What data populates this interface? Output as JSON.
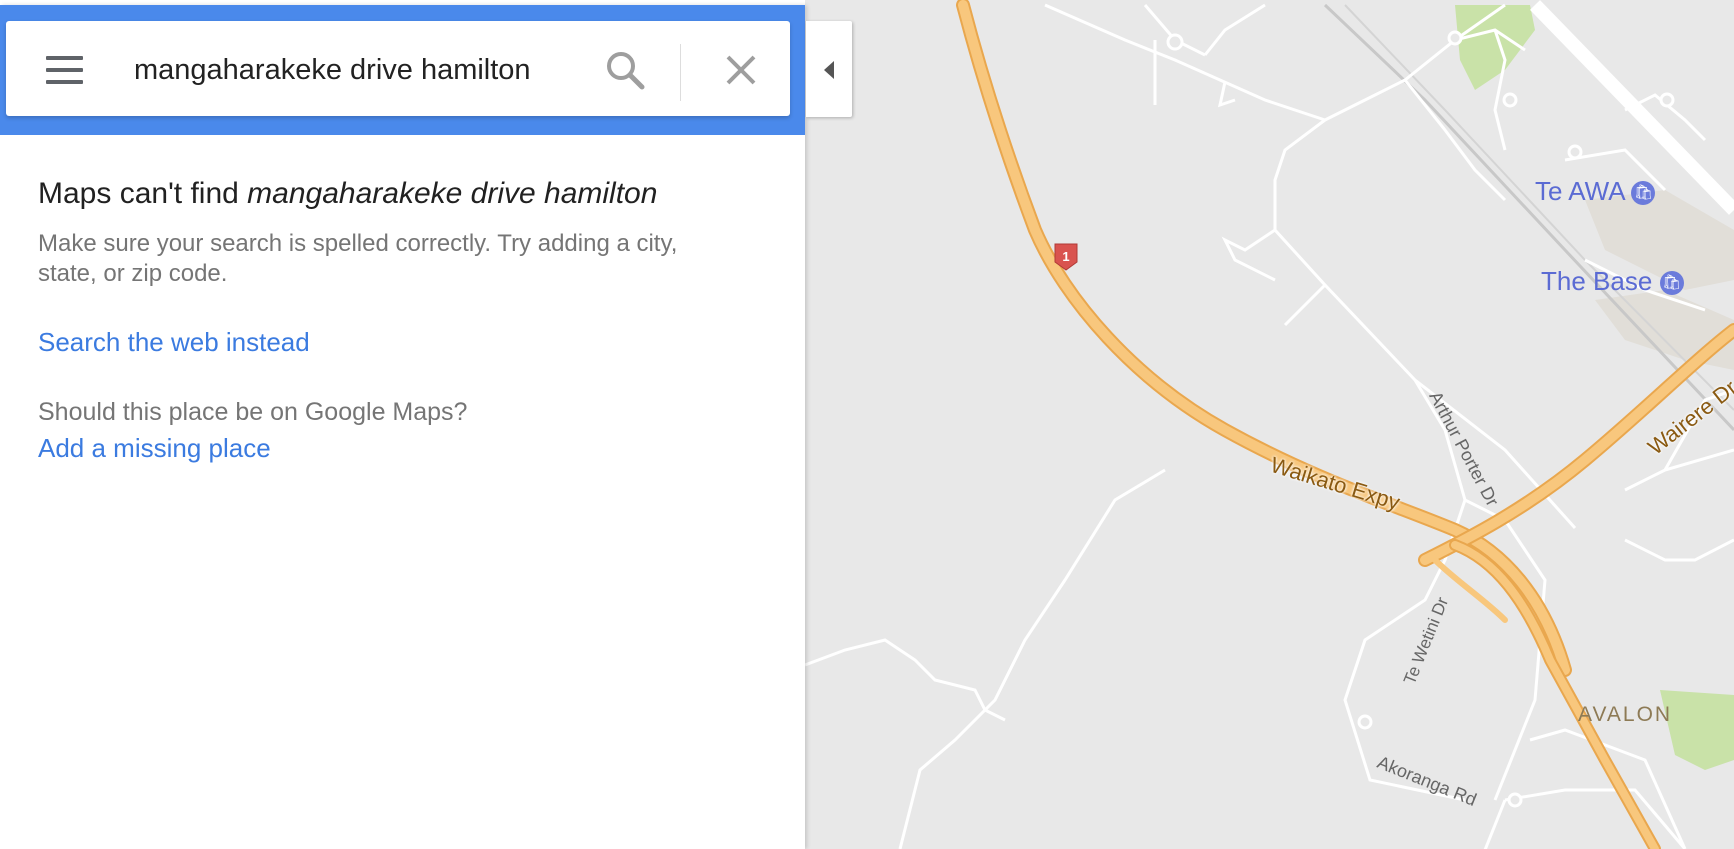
{
  "search": {
    "query": "mangaharakeke drive hamilton",
    "menu_icon": "hamburger-menu-icon",
    "search_icon": "search-icon",
    "close_icon": "close-icon"
  },
  "result": {
    "title_prefix": "Maps can't find ",
    "title_query": "mangaharakeke drive hamilton",
    "hint": "Make sure your search is spelled correctly. Try adding a city, state, or zip code.",
    "web_link": "Search the web instead",
    "question": "Should this place be on Google Maps?",
    "add_link": "Add a missing place"
  },
  "map": {
    "labels": {
      "te_awa": "Te AWA",
      "the_base": "The Base",
      "waikato_expy": "Waikato Expy",
      "wairere_dr": "Wairere Dr",
      "arthur_porter_dr": "Arthur Porter Dr",
      "te_wetini_dr": "Te Wetini Dr",
      "akoranga_rd": "Akoranga Rd",
      "avalon": "AVALON",
      "route_shield": "1"
    },
    "colors": {
      "highway": "#f8c77d",
      "highway_edge": "#e9a74e",
      "poi": "#5b6bd3",
      "park": "#c9e2a8",
      "shield": "#d9534f"
    }
  },
  "colors": {
    "header_blue": "#4a89eb",
    "link_blue": "#3b7be0"
  }
}
